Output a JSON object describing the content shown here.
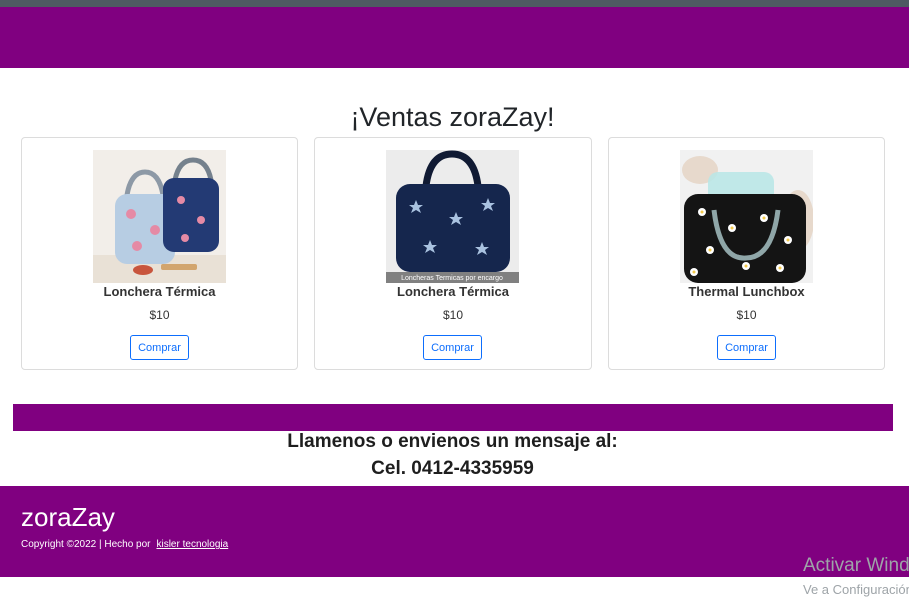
{
  "page": {
    "title": "¡Ventas zoraZay!"
  },
  "products": [
    {
      "name": "Lonchera Térmica",
      "price": "$10",
      "buy_label": "Comprar",
      "image_caption": ""
    },
    {
      "name": "Lonchera Térmica",
      "price": "$10",
      "buy_label": "Comprar",
      "image_caption": "Loncheras Termicas por encargo"
    },
    {
      "name": "Thermal Lunchbox",
      "price": "$10",
      "buy_label": "Comprar",
      "image_caption": ""
    }
  ],
  "contact": {
    "line1": "Llamenos o envienos un mensaje al:",
    "line2": "Cel. 0412-4335959"
  },
  "footer": {
    "brand": "zoraZay",
    "copyright": "Copyright ©2022 | Hecho por",
    "link": "kisler tecnologia"
  },
  "watermark": {
    "line1": "Activar Windows",
    "line2": "Ve a Configuración"
  },
  "colors": {
    "brand_purple": "#800080",
    "topbar": "#4e5a62",
    "button_blue": "#0d6efd"
  }
}
